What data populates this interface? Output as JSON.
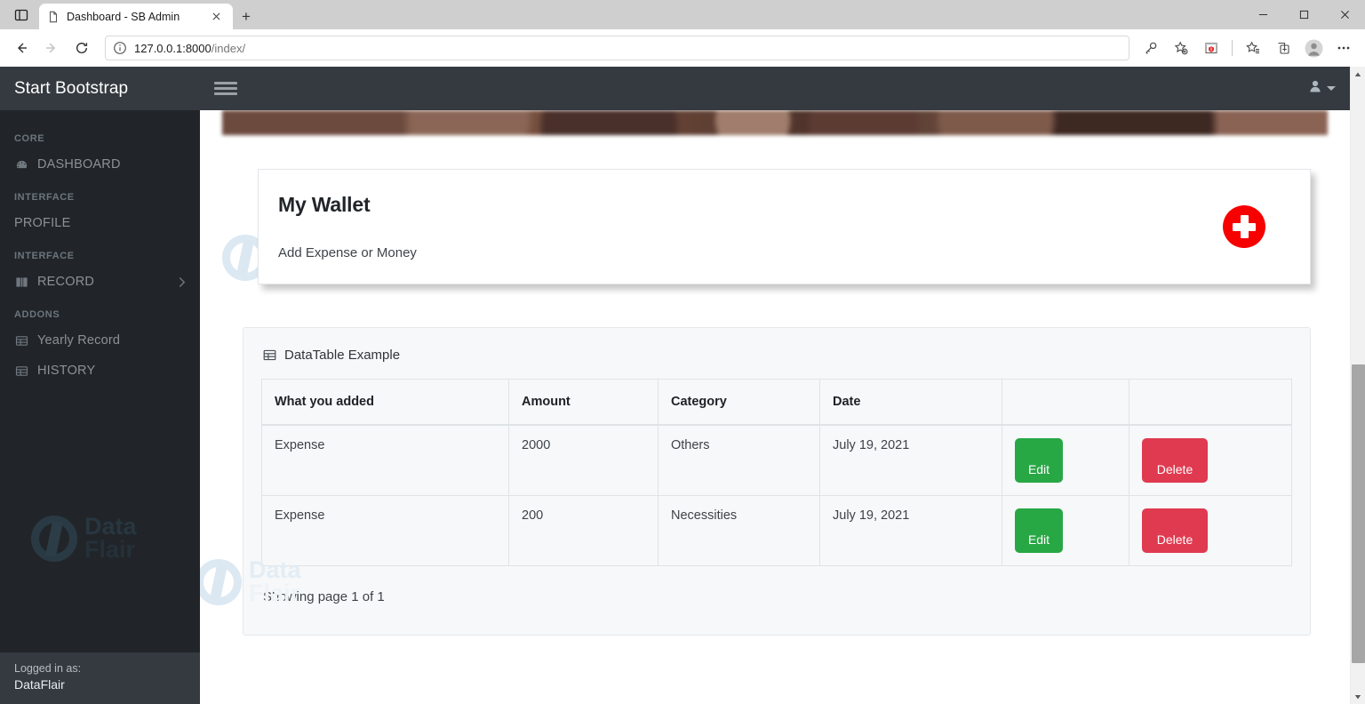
{
  "browser": {
    "tab": {
      "title": "Dashboard - SB Admin",
      "favicon_icon": "page-icon",
      "close_icon": "close-icon"
    },
    "tab_overview_icon": "tab-overview-icon",
    "new_tab_label": "+",
    "window_controls": {
      "minimize": "minimize-icon",
      "maximize": "maximize-icon",
      "close": "close-icon"
    },
    "nav": {
      "back_icon": "back-arrow-icon",
      "forward_icon": "forward-arrow-icon",
      "reload_icon": "reload-icon"
    },
    "omnibox": {
      "info_icon": "info-circle-icon",
      "url_host": "127.0.0.1:8000",
      "url_path": "/index/"
    },
    "toolbar_right": [
      {
        "name": "key-icon",
        "label": "password-manager"
      },
      {
        "name": "add-favorite-icon",
        "label": "add-to-favorites"
      },
      {
        "name": "extension-icon",
        "label": "browser-extension"
      },
      {
        "name": "favorites-icon",
        "label": "favorites"
      },
      {
        "name": "collections-icon",
        "label": "collections"
      },
      {
        "name": "profile-icon",
        "label": "profile"
      },
      {
        "name": "more-icon",
        "label": "settings-and-more"
      }
    ]
  },
  "sidebar": {
    "brand": "Start Bootstrap",
    "sections": [
      {
        "heading": "Core",
        "items": [
          {
            "label": "DASHBOARD",
            "icon": "tachometer-icon",
            "has_chevron": false
          }
        ]
      },
      {
        "heading": "Interface",
        "items": [
          {
            "label": "PROFILE",
            "icon": "",
            "has_chevron": false
          }
        ]
      },
      {
        "heading": "Interface",
        "items": [
          {
            "label": "RECORD",
            "icon": "book-icon",
            "has_chevron": true
          }
        ]
      },
      {
        "heading": "Addons",
        "items": [
          {
            "label": "Yearly Record",
            "icon": "table-icon",
            "has_chevron": false
          },
          {
            "label": "HISTORY",
            "icon": "table-icon",
            "has_chevron": false
          }
        ]
      }
    ],
    "footer": {
      "logged_in_label": "Logged in as:",
      "user": "DataFlair"
    }
  },
  "topnav": {
    "menu_toggle_icon": "hamburger-icon",
    "user_icon": "user-icon",
    "caret_icon": "caret-down-icon"
  },
  "wallet": {
    "title": "My Wallet",
    "subtitle": "Add Expense or Money",
    "add_button_icon": "plus-icon"
  },
  "datatable": {
    "icon": "table-grid-icon",
    "title": "DataTable Example",
    "columns": [
      "What you added",
      "Amount",
      "Category",
      "Date",
      "",
      ""
    ],
    "rows": [
      {
        "what": "Expense",
        "amount": "2000",
        "category": "Others",
        "date": "July 19, 2021",
        "edit_label": "Edit",
        "delete_label": "Delete"
      },
      {
        "what": "Expense",
        "amount": "200",
        "category": "Necessities",
        "date": "July 19, 2021",
        "edit_label": "Edit",
        "delete_label": "Delete"
      }
    ],
    "footer": "Showing page 1 of 1"
  },
  "watermark": {
    "line1": "Data",
    "line2": "Flair"
  },
  "colors": {
    "sidebar_bg": "#212529",
    "navbar_bg": "#343a40",
    "accent_red": "#f70000",
    "btn_edit": "#28a745",
    "btn_delete": "#e03a50"
  }
}
